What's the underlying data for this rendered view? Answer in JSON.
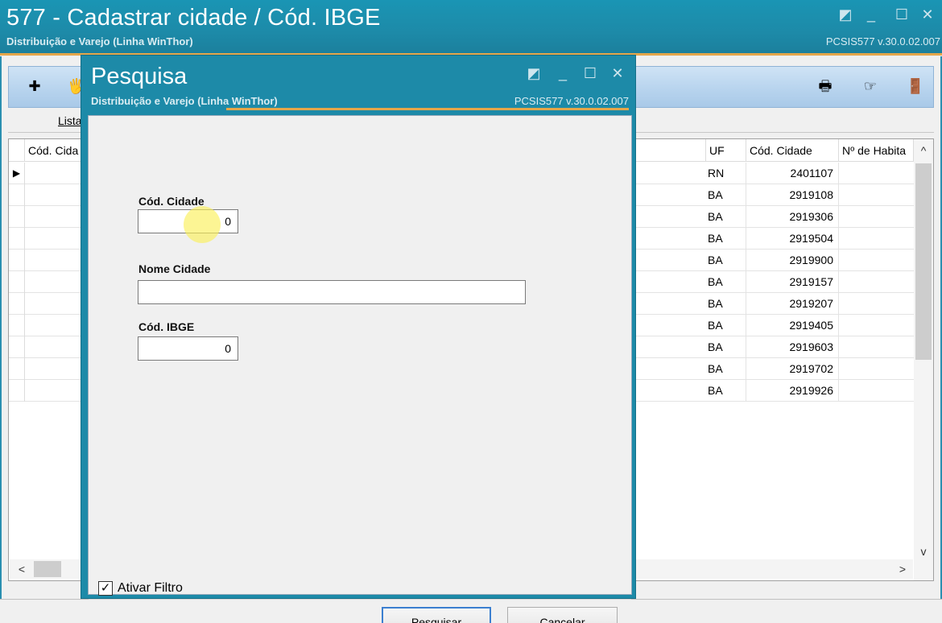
{
  "main_window": {
    "title": "577 - Cadastrar cidade / Cód. IBGE",
    "subtitle": "Distribuição e Varejo (Linha WinThor)",
    "version": "PCSIS577  v.30.0.02.007",
    "controls": [
      "◩",
      "_",
      "☐",
      "✕"
    ],
    "toolbar": {
      "new_icon": "✚",
      "edit_icon": "🖐",
      "print_icon": "🖶",
      "hand_icon": "☞",
      "exit_icon": "🚪"
    },
    "tab_label": "Lista"
  },
  "grid": {
    "columns": {
      "cod_cidade_left": "Cód. Cida",
      "uf": "UF",
      "cod_cidade": "Cód. Cidade",
      "habitantes": "Nº de Habita"
    },
    "rows": [
      {
        "uf": "RN",
        "cod": "2401107"
      },
      {
        "uf": "BA",
        "cod": "2919108"
      },
      {
        "uf": "BA",
        "cod": "2919306"
      },
      {
        "uf": "BA",
        "cod": "2919504"
      },
      {
        "uf": "BA",
        "cod": "2919900"
      },
      {
        "uf": "BA",
        "cod": "2919157"
      },
      {
        "uf": "BA",
        "cod": "2919207"
      },
      {
        "uf": "BA",
        "cod": "2919405"
      },
      {
        "uf": "BA",
        "cod": "2919603"
      },
      {
        "uf": "BA",
        "cod": "2919702"
      },
      {
        "uf": "BA",
        "cod": "2919926"
      }
    ],
    "row_indicator": "▶",
    "scroll_up": "^",
    "scroll_down": "v",
    "scroll_left": "<",
    "scroll_right": ">"
  },
  "dialog": {
    "title": "Pesquisa",
    "subtitle": "Distribuição e Varejo (Linha WinThor)",
    "version": "PCSIS577  v.30.0.02.007",
    "controls": [
      "◩",
      "_",
      "☐",
      "✕"
    ],
    "fields": {
      "cod_cidade_label": "Cód. Cidade",
      "cod_cidade_value": "0",
      "nome_cidade_label": "Nome Cidade",
      "nome_cidade_value": "",
      "cod_ibge_label": "Cód. IBGE",
      "cod_ibge_value": "0"
    },
    "filter": {
      "label": "Ativar Filtro",
      "checked": true,
      "check_glyph": "✓"
    },
    "buttons": {
      "search": "Pesquisar",
      "cancel": "Cancelar"
    }
  }
}
